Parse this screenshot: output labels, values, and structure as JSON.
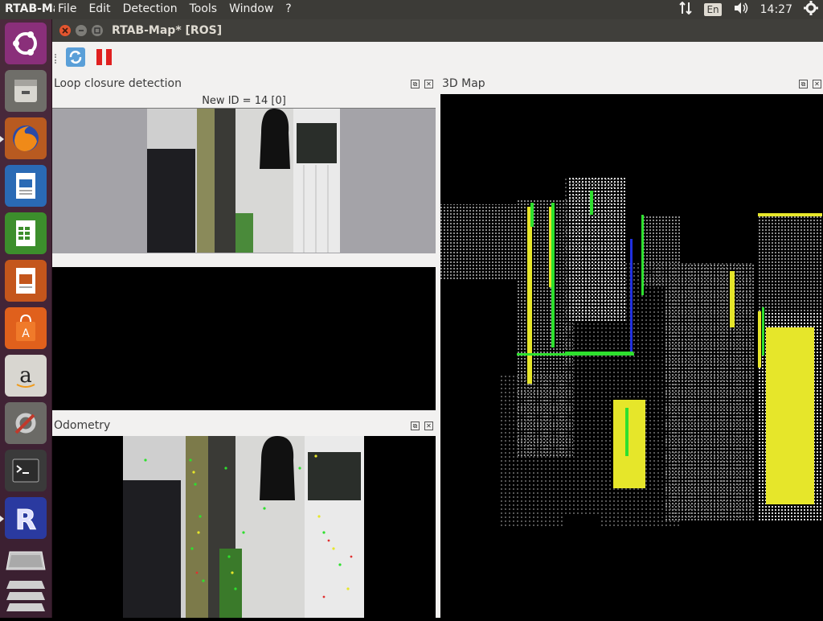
{
  "topbar": {
    "app_name": "RTAB-Map",
    "menus": [
      "File",
      "Edit",
      "Detection",
      "Tools",
      "Window",
      "?"
    ],
    "language": "En",
    "time": "14:27"
  },
  "launcher": {
    "items": [
      "ubuntu-dash-icon",
      "files-icon",
      "firefox-icon",
      "writer-icon",
      "calc-icon",
      "impress-icon",
      "software-center-icon",
      "amazon-icon",
      "system-settings-icon",
      "terminal-icon",
      "rtabmap-icon",
      "workspace-switcher-icon",
      "trash-icon"
    ]
  },
  "window": {
    "title": "RTAB-Map* [ROS]"
  },
  "loop": {
    "title": "Loop closure detection",
    "new_id": "New ID = 14 [0]"
  },
  "odometry": {
    "title": "Odometry"
  },
  "map3d": {
    "title": "3D Map"
  },
  "colors": {
    "accent_green": "#22cc22",
    "accent_yellow": "#e6e62a",
    "accent_blue": "#2030e0"
  }
}
